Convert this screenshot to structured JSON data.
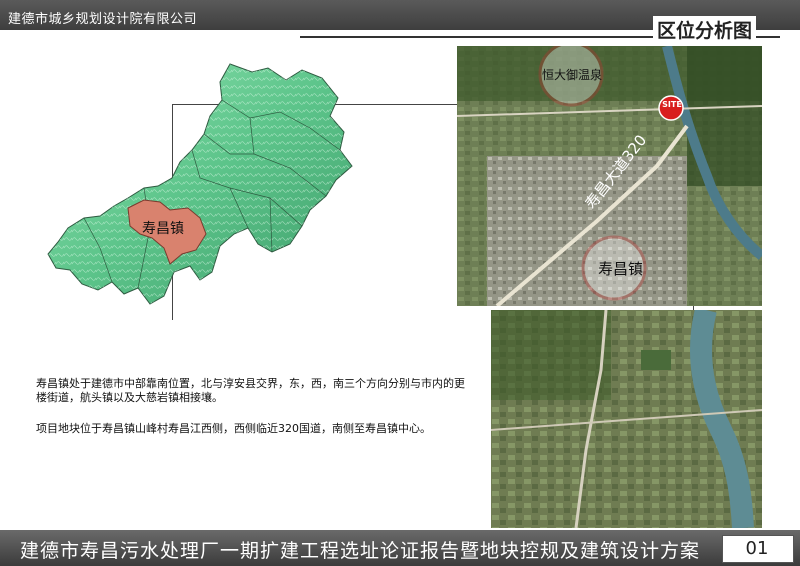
{
  "header": {
    "org_name": "建德市城乡规划设计院有限公司",
    "section_title": "区位分析图"
  },
  "regional_map": {
    "town_label": "寿昌镇",
    "region_color": "#6fcf97",
    "highlight_color": "#d9826e"
  },
  "satellite_top": {
    "poi_label": "恒大御温泉",
    "site_badge": "SITE",
    "road_label": "寿昌大道320",
    "town_label": "寿昌镇",
    "accent_color": "#d81e1e"
  },
  "description": {
    "para1": "寿昌镇处于建德市中部靠南位置，北与淳安县交界，东，西，南三个方向分别与市内的更楼街道，航头镇以及大慈岩镇相接壤。",
    "para2": "项目地块位于寿昌镇山峰村寿昌江西侧，西侧临近320国道，南侧至寿昌镇中心。"
  },
  "footer": {
    "project_title": "建德市寿昌污水处理厂一期扩建工程选址论证报告暨地块控规及建筑设计方案",
    "page_number": "01"
  }
}
